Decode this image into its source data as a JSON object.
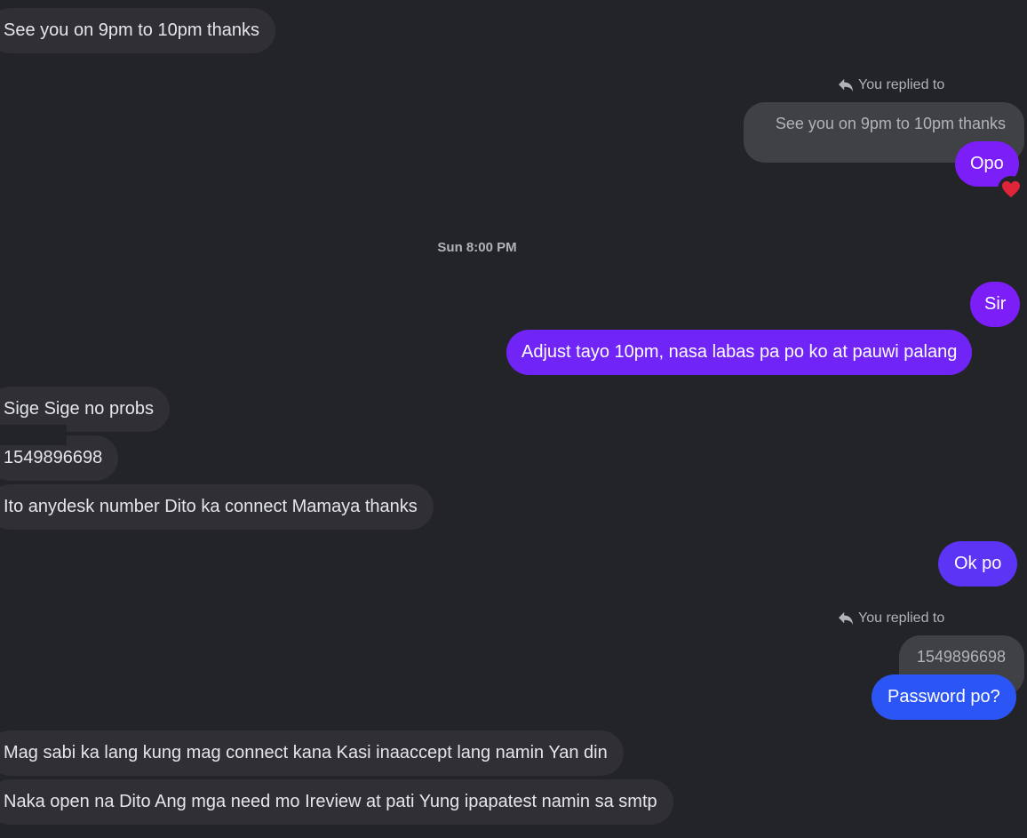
{
  "colors": {
    "background": "#232427",
    "incoming_bubble": "#303034",
    "quoted_bubble": "#404145",
    "outgoing_purple": "#7b1ef7",
    "outgoing_violet": "#5b34f5",
    "outgoing_blue": "#2b55f4",
    "reaction": "#e0243a"
  },
  "messages": {
    "m1": "See you on 9pm to 10pm thanks",
    "reply1": {
      "label": "You replied to",
      "quoted": "See you on 9pm to 10pm thanks",
      "text": "Opo",
      "reaction_icon": "heart-icon"
    },
    "timestamp": "Sun 8:00 PM",
    "m2": "Sir",
    "m3": "Adjust tayo 10pm, nasa labas pa po ko at pauwi palang",
    "m4": "Sige Sige no probs",
    "m5": "1549896698",
    "m6": "Ito anydesk number Dito ka connect Mamaya thanks",
    "m7": "Ok po",
    "reply2": {
      "label": "You replied to",
      "quoted": "1549896698",
      "text": "Password po?"
    },
    "m8": "Mag sabi ka lang kung mag connect kana Kasi inaaccept lang namin Yan din",
    "m9": "Naka open na Dito Ang mga need mo Ireview at pati Yung ipapatest namin sa smtp"
  }
}
